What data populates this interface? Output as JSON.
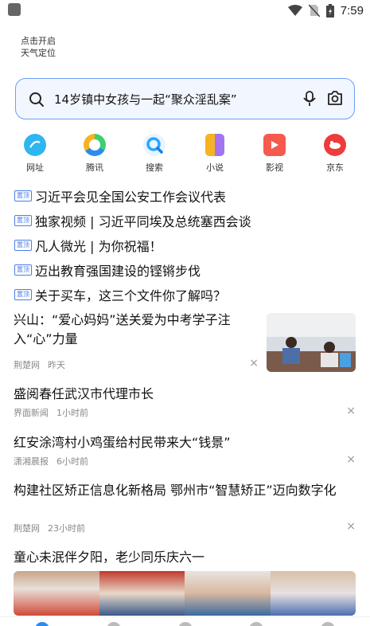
{
  "status_bar": {
    "time": "7:59"
  },
  "weather": {
    "line1": "点击开启",
    "line2": "天气定位"
  },
  "search": {
    "query": "14岁镇中女孩与一起“聚众淫乱案”"
  },
  "quick_links": [
    {
      "label": "网址",
      "icon": "globe-icon",
      "color": "#2fb6f0"
    },
    {
      "label": "腾讯",
      "icon": "tencent-icon",
      "color": "#3ccf6e"
    },
    {
      "label": "搜索",
      "icon": "search-icon",
      "color": "#2aa7ff"
    },
    {
      "label": "小说",
      "icon": "book-icon",
      "color": "#f5b324"
    },
    {
      "label": "影视",
      "icon": "video-icon",
      "color": "#f55a4e"
    },
    {
      "label": "京东",
      "icon": "jd-icon",
      "color": "#ee3b3b"
    }
  ],
  "headline_tag": "置顶",
  "headlines": [
    "习近平会见全国公安工作会议代表",
    "独家视频 | 习近平同埃及总统塞西会谈",
    "凡人微光 | 为你祝福！",
    "迈出教育强国建设的铿锵步伐",
    "关于买车，这三个文件你了解吗？"
  ],
  "feed": [
    {
      "title": "兴山：“爱心妈妈”送关爱为中考学子注入“心”力量",
      "source": "荆楚网",
      "time": "昨天"
    },
    {
      "title": "盛阅春任武汉市代理市长",
      "source": "界面新闻",
      "time": "1小时前"
    },
    {
      "title": "红安涂湾村小鸡蛋给村民带来大“钱景”",
      "source": "潇湘晨报",
      "time": "6小时前"
    },
    {
      "title": "构建社区矫正信息化新格局 鄂州市“智慧矫正”迈向数字化",
      "source": "荆楚网",
      "time": "23小时前"
    },
    {
      "title": "童心未泯伴夕阳，老少同乐庆六一"
    }
  ],
  "close_glyph": "×"
}
